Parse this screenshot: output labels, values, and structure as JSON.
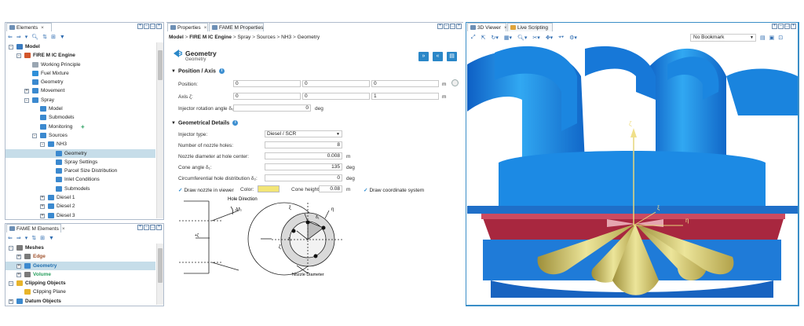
{
  "elements_panel": {
    "tab": "Elements",
    "tree": [
      {
        "label": "Model",
        "lvl": 0,
        "exp": "-",
        "bold": true,
        "icon": "model"
      },
      {
        "label": "FIRE M IC Engine",
        "lvl": 1,
        "exp": "-",
        "bold": true,
        "icon": "engine"
      },
      {
        "label": "Working Principle",
        "lvl": 2,
        "icon": "doc"
      },
      {
        "label": "Fuel Mixture",
        "lvl": 2,
        "icon": "fuel"
      },
      {
        "label": "Geometry",
        "lvl": 2,
        "icon": "geo"
      },
      {
        "label": "Movement",
        "lvl": 2,
        "exp": "+",
        "icon": "move"
      },
      {
        "label": "Spray",
        "lvl": 2,
        "exp": "-",
        "icon": "spray"
      },
      {
        "label": "Model",
        "lvl": 3,
        "icon": "spray"
      },
      {
        "label": "Submodels",
        "lvl": 3,
        "icon": "spray"
      },
      {
        "label": "Monitoring",
        "lvl": 3,
        "icon": "spray",
        "plus": "+"
      },
      {
        "label": "Sources",
        "lvl": 3,
        "exp": "-",
        "icon": "spray"
      },
      {
        "label": "NH3",
        "lvl": 4,
        "exp": "-",
        "icon": "spray"
      },
      {
        "label": "Geometry",
        "lvl": 5,
        "icon": "spray",
        "sel": true
      },
      {
        "label": "Spray Settings",
        "lvl": 5,
        "icon": "spray"
      },
      {
        "label": "Parcel Size Distribution",
        "lvl": 5,
        "icon": "spray"
      },
      {
        "label": "Inlet Conditions",
        "lvl": 5,
        "icon": "spray"
      },
      {
        "label": "Submodels",
        "lvl": 5,
        "icon": "spray"
      },
      {
        "label": "Diesel 1",
        "lvl": 4,
        "exp": "+",
        "icon": "spray"
      },
      {
        "label": "Diesel 2",
        "lvl": 4,
        "exp": "+",
        "icon": "spray"
      },
      {
        "label": "Diesel 3",
        "lvl": 4,
        "exp": "+",
        "icon": "spray"
      }
    ]
  },
  "fame_panel": {
    "tab": "FAME M Elements",
    "tree": [
      {
        "label": "Meshes",
        "lvl": 0,
        "exp": "-",
        "bold": true,
        "icon": "mesh"
      },
      {
        "label": "Edge",
        "lvl": 1,
        "exp": "+",
        "icon": "edge",
        "color": "#a0522d",
        "bold": true
      },
      {
        "label": "Geometry",
        "lvl": 1,
        "exp": "+",
        "icon": "geomesh",
        "color": "#1f6fb0",
        "bold": true,
        "sel": true
      },
      {
        "label": "Volume",
        "lvl": 1,
        "exp": "+",
        "icon": "vol",
        "color": "#2aa060",
        "bold": true
      },
      {
        "label": "Clipping Objects",
        "lvl": 0,
        "exp": "-",
        "bold": true,
        "icon": "clip"
      },
      {
        "label": "Clipping Plane",
        "lvl": 1,
        "icon": "plane"
      },
      {
        "label": "Datum Objects",
        "lvl": 0,
        "exp": "+",
        "bold": true,
        "icon": "datum"
      }
    ]
  },
  "properties": {
    "tabs": [
      "Properties",
      "FAME M Properties"
    ],
    "breadcrumb": [
      "Model",
      "FIRE M IC Engine",
      "Spray",
      "Sources",
      "NH3",
      "Geometry"
    ],
    "title": "Geometry",
    "subtitle": "Geometry",
    "sec1": "Position / Axis",
    "position_label": "Position:",
    "position": [
      "0",
      "0",
      "0"
    ],
    "pos_unit": "m",
    "axis_label": "Axis ζ:",
    "axis": [
      "0",
      "0",
      "1"
    ],
    "axis_unit": "m",
    "rot_label": "Injector rotation angle δ₀:",
    "rot": "0",
    "rot_unit": "deg",
    "sec2": "Geometrical Details",
    "inj_type_label": "Injector type:",
    "inj_type": "Diesel / SCR",
    "holes_label": "Number of nozzle holes:",
    "holes": "8",
    "diam_label": "Nozzle diameter at hole center:",
    "diam": "0.008",
    "diam_unit": "m",
    "cone_label": "Cone angle δ₁:",
    "cone": "135",
    "cone_unit": "deg",
    "circ_label": "Circumferential hole distribution δ₂:",
    "circ": "0",
    "circ_unit": "deg",
    "draw_nozzle": "Draw nozzle in viewer",
    "color_label": "Color:",
    "swatch": "#f2e576",
    "cone_h_label": "Cone height:",
    "cone_h": "0.08",
    "cone_h_unit": "m",
    "draw_coord": "Draw coordinate system",
    "diagram": {
      "hole_dir": "Hole Direction",
      "d2": "Δδ₂",
      "zeta": "+ζ",
      "nozzle_diam": "Nozzle Diameter",
      "zeta2": "ζ",
      "d1": "δ₁",
      "d1b": "δ₁",
      "eta": "η",
      "xi": "ξ"
    }
  },
  "viewer": {
    "tabs": [
      "3D Viewer",
      "Live Scripting"
    ],
    "bookmark": "No Bookmark",
    "axis_v": "ζ",
    "axis_h": "η",
    "axis_x": "ξ"
  },
  "colors": {
    "accent": "#2a87c8",
    "engine": "#1f8fe6",
    "cone": "#e8dc7e",
    "head": "#b3364e"
  }
}
